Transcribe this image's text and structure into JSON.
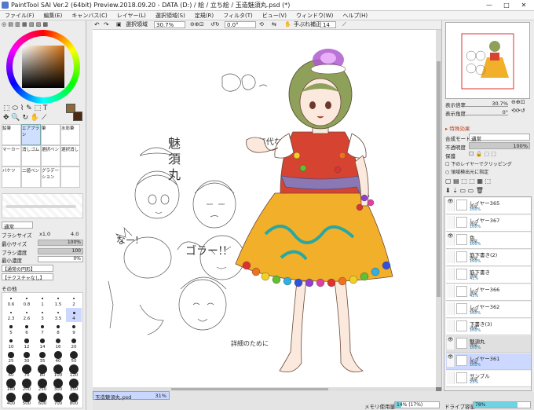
{
  "window": {
    "title": "PaintTool SAI Ver.2 (64bit) Preview.2018.09.20 - DATA (D:) / 絵 / 立ち絵 / 玉造魅須丸.psd (*)",
    "min": "—",
    "max": "□",
    "close": "✕"
  },
  "menu": [
    "ファイル(F)",
    "編集(E)",
    "キャンバス(C)",
    "レイヤー(L)",
    "選択領域(S)",
    "定規(R)",
    "フィルタ(T)",
    "ビュー(V)",
    "ウィンドウ(W)",
    "ヘルプ(H)"
  ],
  "toolbar": {
    "selection_label": "選択領域",
    "zoom": "30.7%",
    "rotation": "0.0°",
    "stabilizer_label": "手ぶれ補正",
    "stabilizer_value": "14"
  },
  "tools": {
    "row1": [
      "鉛筆",
      "エアブラシ",
      "筆",
      "水彩筆"
    ],
    "row2": [
      "マーカー",
      "消しゴム",
      "選択ペン",
      "選択消し"
    ],
    "row3": [
      "バケツ",
      "二値ペン",
      "グラデーション",
      ""
    ]
  },
  "brush": {
    "mode": "通常",
    "size_label": "ブラシサイズ",
    "size_mult": "x1.0",
    "size_value": "4.0",
    "min_size_label": "最小サイズ",
    "min_size_value": "100%",
    "density_label": "ブラシ濃度",
    "density_value": "100",
    "min_density_label": "最小濃度",
    "min_density_value": "0%",
    "shape": "【通常の円形】",
    "texture": "【テクスチャなし】",
    "other_label": "その他"
  },
  "brush_sizes": [
    [
      "0.6",
      "0.8",
      "1",
      "1.5",
      "2"
    ],
    [
      "2.3",
      "2.6",
      "3",
      "3.5",
      "4"
    ],
    [
      "5",
      "6",
      "7",
      "8",
      "9"
    ],
    [
      "10",
      "12",
      "14",
      "16",
      "20"
    ],
    [
      "25",
      "30",
      "35",
      "40",
      "50"
    ],
    [
      "60",
      "70",
      "80",
      "100",
      "120"
    ],
    [
      "160",
      "200",
      "250",
      "300",
      "350"
    ],
    [
      "400",
      "500",
      "600",
      "700",
      "800"
    ]
  ],
  "navigator": {
    "zoom_label": "表示倍率",
    "zoom_value": "30.7%",
    "angle_label": "表示角度",
    "angle_value": "0°"
  },
  "effects_label": "特殊効果",
  "layer_props": {
    "blend_label": "合成モード",
    "blend_value": "通常",
    "opacity_label": "不透明度",
    "opacity_value": "100%",
    "protect_label": "保護",
    "clip_label": "下のレイヤーでクリッピング",
    "detect_label": "領域検出元に指定"
  },
  "layers": [
    {
      "name": "レイヤー365",
      "mode": "通常",
      "opacity": "100%"
    },
    {
      "name": "レイヤー367",
      "mode": "通常",
      "opacity": "100%"
    },
    {
      "name": "色",
      "mode": "通常",
      "opacity": "100%"
    },
    {
      "name": "筋下書き(2)",
      "mode": "通常",
      "opacity": "100%"
    },
    {
      "name": "筋下書き",
      "mode": "通常",
      "opacity": "41%"
    },
    {
      "name": "レイヤー366",
      "mode": "通常",
      "opacity": "43%"
    },
    {
      "name": "レイヤー362",
      "mode": "通常",
      "opacity": "100%"
    },
    {
      "name": "下書き(3)",
      "mode": "通常",
      "opacity": "100%"
    },
    {
      "name": "魅須丸",
      "mode": "通常",
      "opacity": "100%"
    },
    {
      "name": "レイヤー361",
      "mode": "通常",
      "opacity": "100%"
    },
    {
      "name": "サンプル",
      "mode": "通常",
      "opacity": "23%"
    }
  ],
  "status": {
    "file_tab": "玉造魅須丸.psd",
    "file_zoom": "31%",
    "memory_label": "メモリ使用量",
    "memory_value": "14% (17%)",
    "memory_fraction": 0.14,
    "drive_label": "ドライブ容量",
    "drive_value": "78%",
    "drive_fraction": 0.78
  },
  "colors": {
    "accent": "#3a6ee8",
    "sel_layer": "#ccd8ff",
    "swatch_main": "#8a6a3a",
    "swatch_sub": "#4a2a10"
  }
}
